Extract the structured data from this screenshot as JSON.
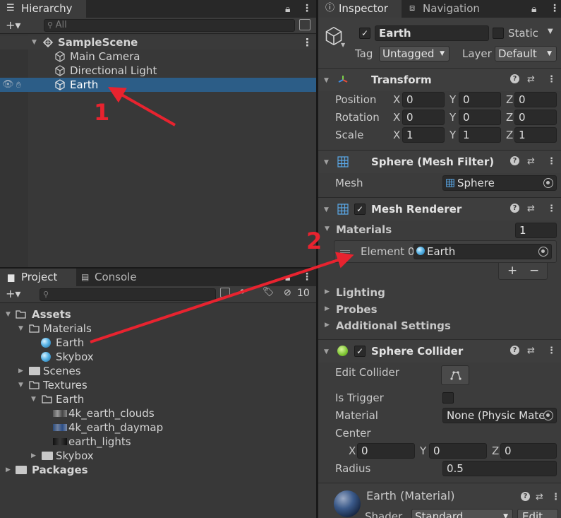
{
  "hierarchy": {
    "tab_label": "Hierarchy",
    "add_label": "+▾",
    "search_placeholder": "All",
    "scene_name": "SampleScene",
    "items": [
      {
        "label": "Main Camera"
      },
      {
        "label": "Directional Light"
      },
      {
        "label": "Earth"
      }
    ]
  },
  "project": {
    "tab_label": "Project",
    "console_label": "Console",
    "add_label": "+▾",
    "hidden_count": "10",
    "tree": {
      "assets": "Assets",
      "materials": "Materials",
      "mat_earth": "Earth",
      "mat_skybox": "Skybox",
      "scenes": "Scenes",
      "textures": "Textures",
      "tex_earth": "Earth",
      "clouds": "4k_earth_clouds",
      "daymap": "4k_earth_daymap",
      "lights": "earth_lights",
      "tex_skybox": "Skybox",
      "packages": "Packages"
    }
  },
  "inspector": {
    "tab_label": "Inspector",
    "nav_tab_label": "Navigation",
    "object_name": "Earth",
    "static_label": "Static",
    "tag_label": "Tag",
    "tag_value": "Untagged",
    "layer_label": "Layer",
    "layer_value": "Default",
    "transform": {
      "title": "Transform",
      "position_label": "Position",
      "rotation_label": "Rotation",
      "scale_label": "Scale",
      "x": "X",
      "y": "Y",
      "z": "Z",
      "position": [
        "0",
        "0",
        "0"
      ],
      "rotation": [
        "0",
        "0",
        "0"
      ],
      "scale": [
        "1",
        "1",
        "1"
      ]
    },
    "mesh_filter": {
      "title": "Sphere (Mesh Filter)",
      "mesh_label": "Mesh",
      "mesh_value": "Sphere"
    },
    "mesh_renderer": {
      "title": "Mesh Renderer",
      "materials_label": "Materials",
      "materials_count": "1",
      "element_label": "Element 0",
      "element_value": "Earth",
      "plus": "+",
      "minus": "−",
      "lighting": "Lighting",
      "probes": "Probes",
      "additional": "Additional Settings"
    },
    "sphere_collider": {
      "title": "Sphere Collider",
      "edit_label": "Edit Collider",
      "trigger_label": "Is Trigger",
      "material_label": "Material",
      "material_value": "None (Physic Mate",
      "center_label": "Center",
      "x": "X",
      "y": "Y",
      "z": "Z",
      "center": [
        "0",
        "0",
        "0"
      ],
      "radius_label": "Radius",
      "radius_value": "0.5"
    },
    "material": {
      "title": "Earth (Material)",
      "shader_label": "Shader",
      "shader_value": "Standard",
      "edit_label": "Edit..."
    }
  },
  "annotations": {
    "step1": "1",
    "step2": "2",
    "arrow_color": "#e8232f"
  }
}
